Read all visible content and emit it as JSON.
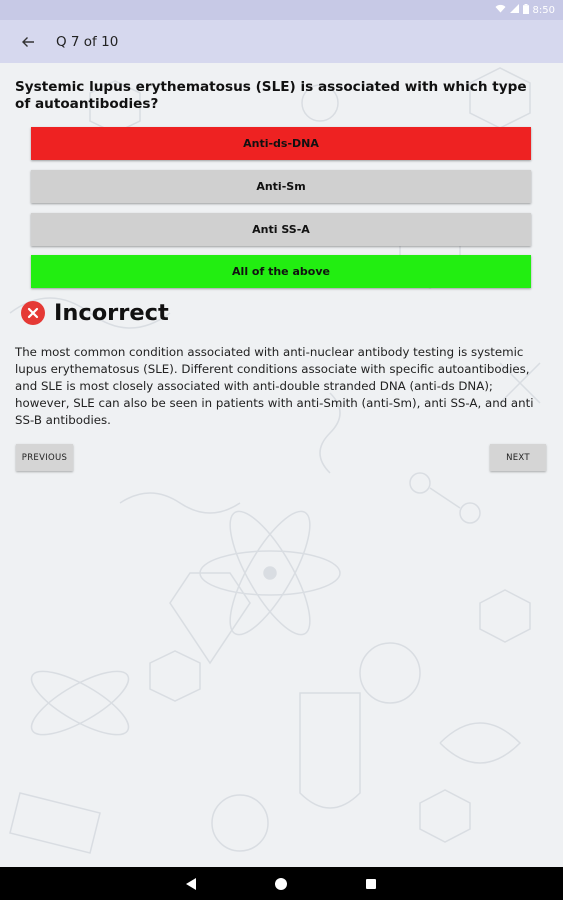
{
  "status_bar": {
    "time": "8:50",
    "icons": [
      "wifi-icon",
      "signal-icon",
      "battery-icon"
    ]
  },
  "app_bar": {
    "title": "Q 7 of 10",
    "back_icon": "arrow-back-icon"
  },
  "question": {
    "text": "Systemic lupus erythematosus (SLE) is associated with which type of autoantibodies?"
  },
  "answers": [
    {
      "label": "Anti-ds-DNA",
      "state": "selected-wrong",
      "color": "#ee2222"
    },
    {
      "label": "Anti-Sm",
      "state": "neutral",
      "color": "#d0d0d0"
    },
    {
      "label": "Anti SS-A",
      "state": "neutral",
      "color": "#d0d0d0"
    },
    {
      "label": "All of the above",
      "state": "correct",
      "color": "#22ee11"
    }
  ],
  "result": {
    "icon": "error-circle-icon",
    "text": "Incorrect",
    "color": "#e53935"
  },
  "explanation": "The most common condition associated with anti-nuclear antibody testing is systemic lupus erythematosus (SLE). Different conditions associate with specific autoantibodies, and SLE is most closely associated with anti-double stranded DNA (anti-ds DNA); however, SLE can also be seen in patients with anti-Smith (anti-Sm), anti SS-A, and anti SS-B antibodies.",
  "navigation": {
    "previous_label": "PREVIOUS",
    "next_label": "NEXT"
  },
  "system_nav": {
    "icons": [
      "back-triangle-icon",
      "home-circle-icon",
      "recents-square-icon"
    ]
  },
  "colors": {
    "status_bar": "#c7c9e6",
    "app_bar": "#d6d8ee",
    "background": "#eff1f3",
    "wrong": "#ee2222",
    "correct": "#22ee11",
    "neutral": "#d0d0d0"
  }
}
